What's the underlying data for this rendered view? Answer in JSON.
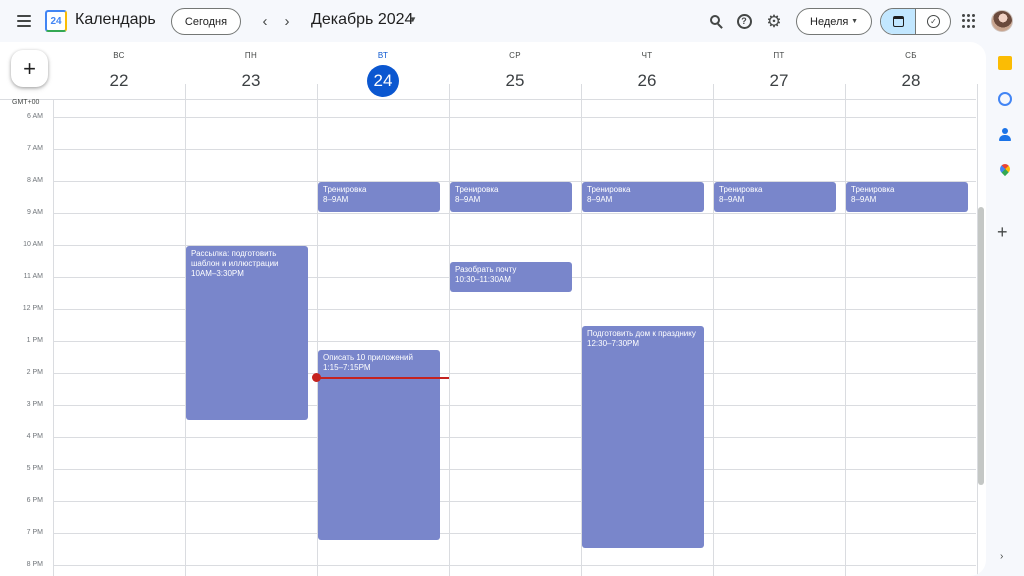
{
  "header": {
    "app_title": "Календарь",
    "logo_text": "24",
    "today_label": "Сегодня",
    "prev_label": "‹",
    "next_label": "›",
    "period_title": "Декабрь 2024",
    "view_select": "Неделя"
  },
  "icons": {
    "menu": "menu-icon",
    "search": "search-icon",
    "help": "help-icon",
    "settings": "gear-icon",
    "calendar_view": "calendar-icon",
    "tasks_view": "check-circle-icon",
    "apps": "apps-grid-icon"
  },
  "colors": {
    "event": "#7986cb",
    "today": "#0b57d0",
    "now_line": "#c5221f",
    "toggle_active": "#c2e7ff"
  },
  "timezone": "GMT+00",
  "days": [
    {
      "dow": "ВС",
      "num": "22",
      "today": false
    },
    {
      "dow": "ПН",
      "num": "23",
      "today": false
    },
    {
      "dow": "ВТ",
      "num": "24",
      "today": true
    },
    {
      "dow": "СР",
      "num": "25",
      "today": false
    },
    {
      "dow": "ЧТ",
      "num": "26",
      "today": false
    },
    {
      "dow": "ПТ",
      "num": "27",
      "today": false
    },
    {
      "dow": "СБ",
      "num": "28",
      "today": false
    }
  ],
  "hours": [
    "6 AM",
    "7 AM",
    "8 AM",
    "9 AM",
    "10 AM",
    "11 AM",
    "12 PM",
    "1 PM",
    "2 PM",
    "3 PM",
    "4 PM",
    "5 PM",
    "6 PM",
    "7 PM",
    "8 PM"
  ],
  "events": [
    {
      "day": 2,
      "start": 8,
      "end": 9,
      "title": "Тренировка",
      "time": "8–9AM"
    },
    {
      "day": 3,
      "start": 8,
      "end": 9,
      "title": "Тренировка",
      "time": "8–9AM"
    },
    {
      "day": 4,
      "start": 8,
      "end": 9,
      "title": "Тренировка",
      "time": "8–9AM"
    },
    {
      "day": 5,
      "start": 8,
      "end": 9,
      "title": "Тренировка",
      "time": "8–9AM"
    },
    {
      "day": 6,
      "start": 8,
      "end": 9,
      "title": "Тренировка",
      "time": "8–9AM"
    },
    {
      "day": 1,
      "start": 10,
      "end": 15.5,
      "title": "Рассылка: подготовить шаблон и иллюстрации",
      "time": "10AM–3:30PM"
    },
    {
      "day": 3,
      "start": 10.5,
      "end": 11.5,
      "title": "Разобрать почту",
      "time": "10:30–11:30AM"
    },
    {
      "day": 2,
      "start": 13.25,
      "end": 19.25,
      "title": "Описать 10 приложений",
      "time": "1:15–7:15PM"
    },
    {
      "day": 4,
      "start": 12.5,
      "end": 19.5,
      "title": "Подготовить дом к празднику",
      "time": "12:30–7:30PM"
    }
  ],
  "side_panel": {
    "icons": [
      "keep-icon",
      "tasks-icon",
      "contacts-icon",
      "maps-icon"
    ],
    "add_label": "+",
    "expand_label": "›"
  }
}
